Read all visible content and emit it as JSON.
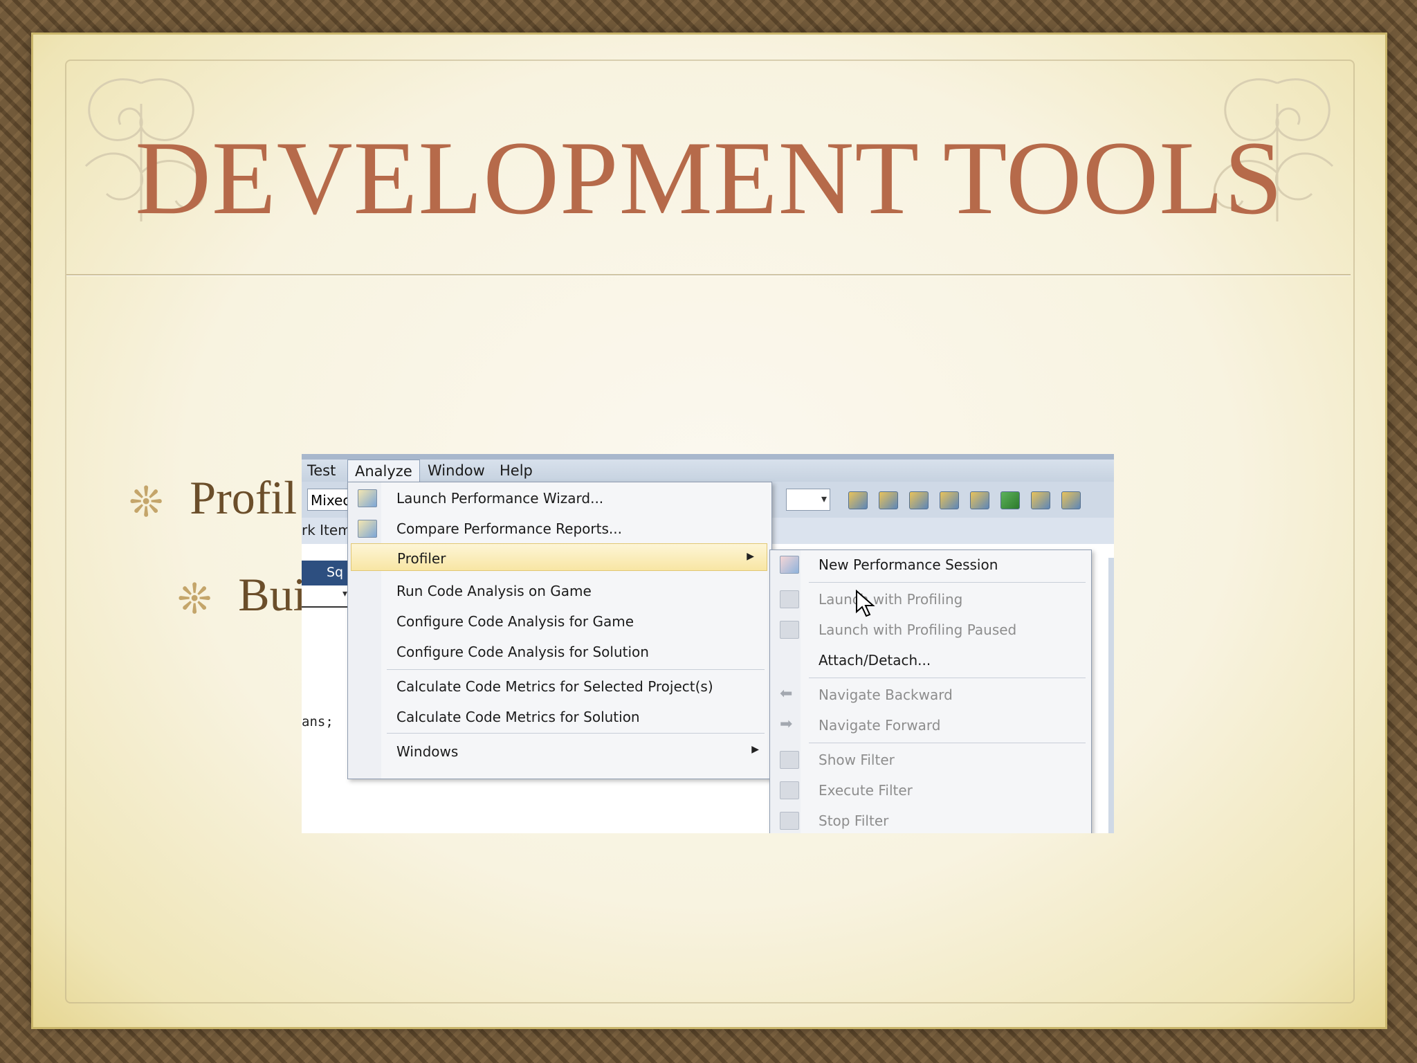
{
  "slide": {
    "title": "DEVELOPMENT TOOLS",
    "bullets": [
      {
        "text": "Profil",
        "level": 1
      },
      {
        "text": "Bui",
        "level": 2
      }
    ],
    "bullet_glyph": "❊"
  },
  "screenshot": {
    "menubar": [
      "Test",
      "Analyze",
      "Window",
      "Help"
    ],
    "toolbar_combo": "Mixec",
    "work_item_label": "rk Item",
    "tab_label": "Sq",
    "code_fragment": "ans;",
    "analyze_menu": [
      {
        "label": "Launch Performance Wizard...",
        "icon": "performance-wizard-icon"
      },
      {
        "label": "Compare Performance Reports...",
        "icon": "compare-reports-icon"
      },
      {
        "label": "Profiler",
        "submenu": true,
        "highlighted": true
      },
      {
        "label": "Run Code Analysis on Game"
      },
      {
        "label": "Configure Code Analysis for Game"
      },
      {
        "label": "Configure Code Analysis for Solution"
      },
      {
        "label": "Calculate Code Metrics for Selected Project(s)"
      },
      {
        "label": "Calculate Code Metrics for Solution"
      },
      {
        "label": "Windows",
        "submenu": true
      }
    ],
    "profiler_submenu": [
      {
        "label": "New Performance Session",
        "enabled": true,
        "icon": "new-session-icon"
      },
      {
        "label": "Launch with Profiling",
        "enabled": false,
        "icon": "launch-profiling-icon"
      },
      {
        "label": "Launch with Profiling Paused",
        "enabled": false,
        "icon": "launch-paused-icon"
      },
      {
        "label": "Attach/Detach...",
        "enabled": true
      },
      {
        "label": "Navigate Backward",
        "enabled": false,
        "icon": "arrow-left-icon"
      },
      {
        "label": "Navigate Forward",
        "enabled": false,
        "icon": "arrow-right-icon"
      },
      {
        "label": "Show Filter",
        "enabled": false,
        "icon": "show-filter-icon"
      },
      {
        "label": "Execute Filter",
        "enabled": false,
        "icon": "execute-filter-icon"
      },
      {
        "label": "Stop Filter",
        "enabled": false,
        "icon": "stop-filter-icon"
      }
    ]
  },
  "colors": {
    "title": "#b66a4a",
    "bullet_text": "#6b4e2a",
    "menu_highlight": "#f8e6a4",
    "disabled_text": "#8d8d8d"
  }
}
